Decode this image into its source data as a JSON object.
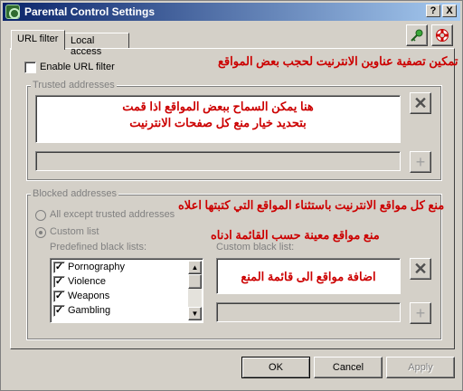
{
  "window": {
    "title": "Parental Control Settings",
    "help_glyph": "?",
    "close_glyph": "X"
  },
  "tabs": [
    {
      "label": "URL filter",
      "active": true
    },
    {
      "label": "Local access",
      "active": false
    }
  ],
  "url_filter": {
    "enable_label": "Enable URL filter",
    "enable_checked": false,
    "annotation": "تمكين تصفية عناوين الانترنيت لحجب بعض المواقع"
  },
  "trusted": {
    "group_label": "Trusted addresses",
    "annotation_line1": "هنا يمكن السماح ببعض المواقع اذا قمت",
    "annotation_line2": "بتحديد خيار منع كل صفحات الانترنيت",
    "input_value": ""
  },
  "blocked": {
    "group_label": "Blocked addresses",
    "radio_all_label": "All except trusted addresses",
    "radio_custom_label": "Custom list",
    "annotation_all": "منع كل مواقع الانترنيت باستثناء المواقع التي كتبتها اعلاه",
    "annotation_custom": "منع مواقع معينة حسب القائمة ادناه",
    "predefined_label": "Predefined black lists:",
    "custom_label": "Custom black list:",
    "custom_annotation": "اضافة مواقع الى قائمة المنع",
    "predefined_items": [
      {
        "label": "Pornography",
        "checked": true
      },
      {
        "label": "Violence",
        "checked": true
      },
      {
        "label": "Weapons",
        "checked": true
      },
      {
        "label": "Gambling",
        "checked": true
      }
    ],
    "check_glyph": "✓"
  },
  "glyphs": {
    "remove": "✕",
    "add": "+"
  },
  "buttons": {
    "ok": "OK",
    "cancel": "Cancel",
    "apply": "Apply"
  },
  "colors": {
    "annotation": "#cc0000",
    "title_start": "#0a246a",
    "title_end": "#a6caf0"
  }
}
